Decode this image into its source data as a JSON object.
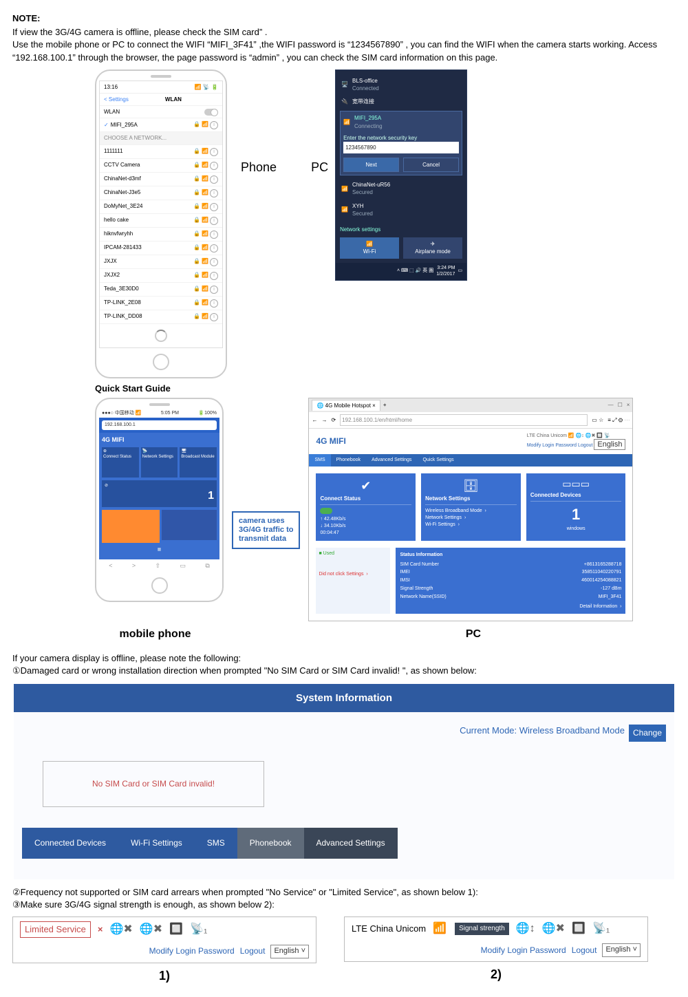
{
  "note": {
    "title": "NOTE:",
    "line1a": "If view the 3G/4G camera is offline, please check the SIM card",
    "line1b": "” .",
    "line2a": "Use the mobile phone or PC to connect the WIFI “MIFI_3F41” ,the WIFI password is “1234567890” , you can find the WIFI when the camera starts working. Access “192.168.100.1” through the browser, the page password is “admin” , you can check the SIM card information on this page."
  },
  "phone1": {
    "time": "13:16",
    "back": "Settings",
    "title": "WLAN",
    "wlan": "WLAN",
    "connected": "MIFI_295A",
    "choose": "CHOOSE A NETWORK...",
    "nets": [
      "1111111",
      "CCTV Camera",
      "ChinaNet-d3mf",
      "ChinaNet-J3e5",
      "DoMyNet_3E24",
      "hello cake",
      "hiknvfwryhh",
      "IPCAM-281433",
      "JXJX",
      "JXJX2",
      "Teda_3E30D0",
      "TP-LINK_2E08",
      "TP-LINK_DD08"
    ]
  },
  "pc1": {
    "top1": "BLS-office",
    "top1s": "Connected",
    "top2": "宽带连接",
    "sel": "MIFI_295A",
    "sels": "Connecting",
    "prompt": "Enter the network security key",
    "pwd": "1234567890",
    "next": "Next",
    "cancel": "Cancel",
    "n1": "ChinaNet-uR56",
    "n1s": "Secured",
    "n2": "XYH",
    "n2s": "Secured",
    "link": "Network settings",
    "wifi": "Wi-Fi",
    "air": "Airplane mode",
    "clock": "3:24 PM",
    "date": "1/2/2017"
  },
  "labels": {
    "phone": "Phone",
    "pc": "PC",
    "mobile": "mobile phone",
    "pc2": "PC",
    "qsg": "Quick Start Guide"
  },
  "mobile2": {
    "url": "192.168.100.1",
    "title": "4G MIFI",
    "t1": "Connect Status",
    "t2": "Network Settings",
    "t3": "Broadcast Module",
    "num": "1"
  },
  "callout": {
    "l1": "camera uses",
    "l2": "3G/4G traffic to",
    "l3": "transmit data"
  },
  "pcwin": {
    "tab": "4G Mobile Hotspot",
    "url": "192.168.100.1",
    "logo": "4G MIFI",
    "rtxt": "LTE  China Unicom",
    "rlinks": "Modify Login Password   Logout",
    "lang": "English",
    "tabs": [
      "SMS",
      "Phonebook",
      "Advanced Settings",
      "Quick Settings"
    ],
    "c1": "Connect Status",
    "c1a": "42.48Kb/s",
    "c1b": "34.10Kb/s",
    "c1c": "00:04:47",
    "c2": "Network Settings",
    "c2a": "Wireless Broadband Mode",
    "c2b": "Network Settings",
    "c2c": "Wi-Fi Settings",
    "c3": "Connected Devices",
    "c3n": "1",
    "c3a": "windows",
    "info_l1": "Used",
    "info_l2": "Did not click Settings",
    "info_t": "Status Information",
    "kv": [
      {
        "k": "SIM Card Number",
        "v": "+8613165288718"
      },
      {
        "k": "IMEI",
        "v": "358511040220791"
      },
      {
        "k": "IMSI",
        "v": "460014254088821"
      },
      {
        "k": "Signal Strength",
        "v": "-127 dBm"
      },
      {
        "k": "Network Name(SSID)",
        "v": "MIFI_3F41"
      }
    ],
    "detail": "Detail Information"
  },
  "sec": {
    "intro": "If your camera display is offline, please note the following:",
    "p1": "①Damaged card or wrong installation direction when prompted \"No SIM Card or SIM Card invalid! \", as shown below:",
    "p2": "②Frequency not supported or SIM card arrears when prompted \"No Service\" or \"Limited Service\", as shown below 1):",
    "p3": "③Make sure 3G/4G signal strength is enough, as shown below 2):"
  },
  "sysinfo": {
    "title": "System Information",
    "mode": "Current Mode: Wireless Broadband Mode",
    "change": "Change",
    "nosim": "No SIM Card or SIM Card invalid!",
    "tabs": [
      "Connected Devices",
      "Wi-Fi Settings",
      "SMS",
      "Phonebook",
      "Advanced Settings"
    ]
  },
  "svc1": {
    "lim": "Limited Service",
    "mod": "Modify Login Password",
    "out": "Logout",
    "lang": "English ˅"
  },
  "svc2": {
    "lte": "LTE  China Unicom",
    "sig": "Signal strength",
    "mod": "Modify Login Password",
    "out": "Logout",
    "lang": "English ˅"
  },
  "num": {
    "n1": "1)",
    "n2": "2)"
  }
}
